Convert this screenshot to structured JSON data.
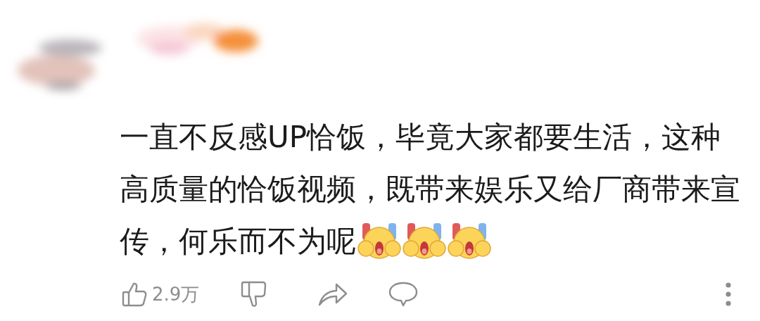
{
  "comment": {
    "lines": [
      "一直不反感UP恰饭，毕竟大家都要生活，这种",
      "高质量的恰饭视频，既带来娱乐又给厂商带来宣",
      "传，何乐而不为呢"
    ],
    "emojis": [
      {
        "kind": "glowstick-face"
      },
      {
        "kind": "glowstick-face"
      },
      {
        "kind": "glowstick-face"
      }
    ]
  },
  "actions": {
    "like_count": "2.9万"
  }
}
